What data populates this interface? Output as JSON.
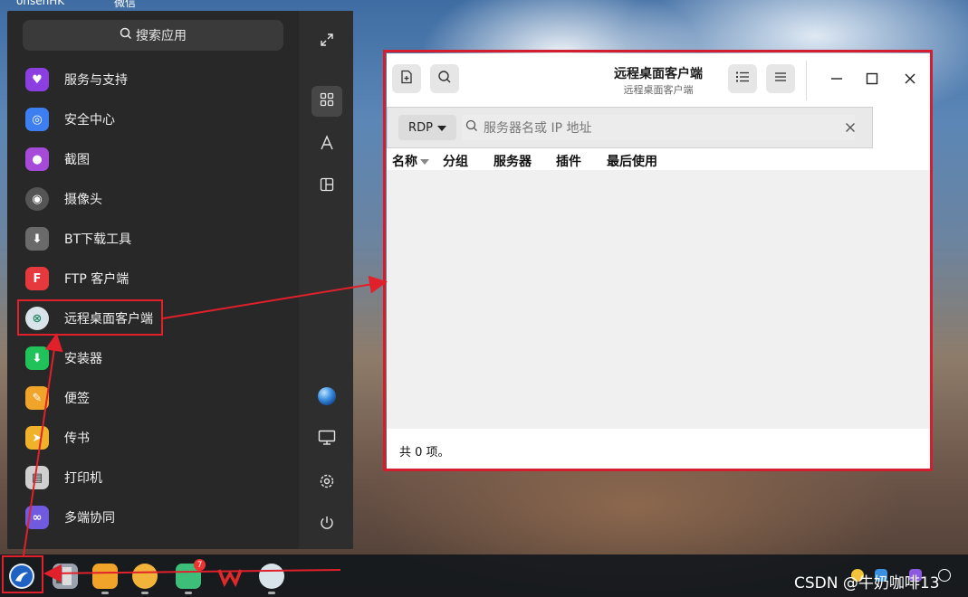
{
  "desktop": {
    "top_labels": [
      "onsenHK",
      "微信"
    ]
  },
  "launcher": {
    "search_placeholder": "搜索应用",
    "apps": [
      {
        "label": "服务与支持",
        "color": "#8b3fe0",
        "glyph": "♥"
      },
      {
        "label": "安全中心",
        "color": "#3d7ef0",
        "glyph": "◎"
      },
      {
        "label": "截图",
        "color": "#a64ad9",
        "glyph": "●"
      },
      {
        "label": "摄像头",
        "color": "#555555",
        "glyph": "◉"
      },
      {
        "label": "BT下载工具",
        "color": "#6a6a6a",
        "glyph": "⬇"
      },
      {
        "label": "FTP 客户端",
        "color": "#e5393d",
        "glyph": "F"
      },
      {
        "label": "远程桌面客户端",
        "color": "#d9e4ea",
        "glyph": "⊗"
      },
      {
        "label": "安装器",
        "color": "#22c25a",
        "glyph": "⬇"
      },
      {
        "label": "便签",
        "color": "#f0a42a",
        "glyph": "✎"
      },
      {
        "label": "传书",
        "color": "#f0b22a",
        "glyph": "➤"
      },
      {
        "label": "打印机",
        "color": "#cfcfcf",
        "glyph": "▤"
      },
      {
        "label": "多端协同",
        "color": "#6f5ae0",
        "glyph": "∞"
      }
    ]
  },
  "window": {
    "title": "远程桌面客户端",
    "subtitle": "远程桌面客户端",
    "protocol": "RDP",
    "address_placeholder": "服务器名或 IP 地址",
    "columns": [
      "名称",
      "分组",
      "服务器",
      "插件",
      "最后使用"
    ],
    "status": "共 0 项。"
  },
  "taskbar": {
    "badge_count": "7"
  },
  "watermark": "CSDN @牛奶咖啡13"
}
